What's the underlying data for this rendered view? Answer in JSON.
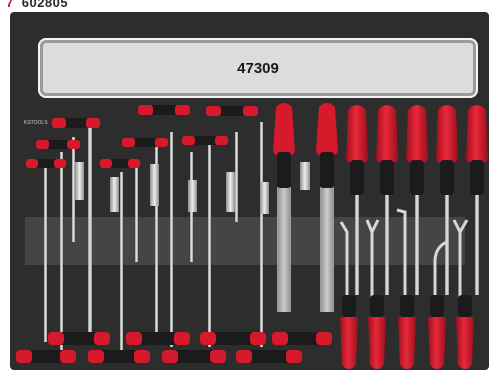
{
  "header": {
    "marker": "7",
    "code": "602805"
  },
  "tray": {
    "label": "47309",
    "brand": "KSTOOLS"
  },
  "colors": {
    "tray": "#2d2d2d",
    "handle_red": "#d7192c",
    "handle_black": "#1b1b1b",
    "steel": "#c9c9c9"
  }
}
